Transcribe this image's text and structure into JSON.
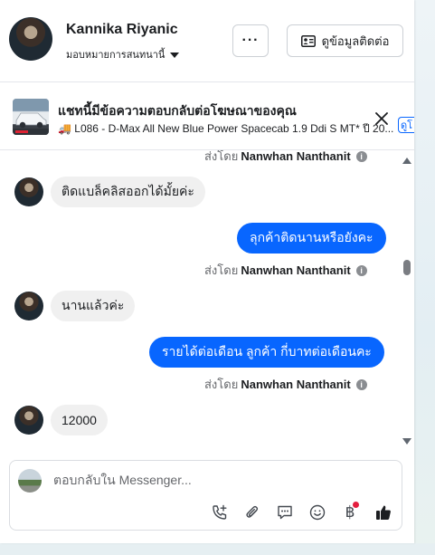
{
  "header": {
    "contact_name": "Kannika Riyanic",
    "assignment": "มอบหมายการสนทนานี้",
    "more_label": "···",
    "contact_info_label": "ดูข้อมูลติดต่อ"
  },
  "banner": {
    "title": "แชทนี้มีข้อความตอบกลับต่อโฆษณาของคุณ",
    "subtitle": "🚚 L086 - D-Max All New Blue Power Spacecab 1.9 Ddi S MT* ปี 20...",
    "link_label": "ดูโ"
  },
  "messages": {
    "partial_sent_by": "ส่งโดย",
    "partial_sender": "Nanwhan Nanthanit",
    "m1_text": "ติดแบล็คลิสออกได้มั้ยค่ะ",
    "m2_text": "ลุกค้าติดนานหรือยังคะ",
    "m2_sent_by": "ส่งโดย",
    "m2_sender": "Nanwhan Nanthanit",
    "m3_text": "นานแล้วค่ะ",
    "m4_text": "รายได้ต่อเดือน ลูกค้า  กี่บาทต่อเดือนคะ",
    "m4_sent_by": "ส่งโดย",
    "m4_sender": "Nanwhan Nanthanit",
    "m5_text": "12000"
  },
  "composer": {
    "placeholder": "ตอบกลับใน Messenger...",
    "currency_symbol": "฿"
  },
  "colors": {
    "accent": "#0866ff",
    "incoming_bubble": "#f0f0f0",
    "notification_dot": "#e41e3f"
  },
  "icons": [
    "more-icon",
    "contact-card-icon",
    "close-icon",
    "phone-add-icon",
    "attachment-icon",
    "chat-bubble-icon",
    "emoji-icon",
    "baht-icon",
    "thumbs-up-icon",
    "info-icon"
  ]
}
